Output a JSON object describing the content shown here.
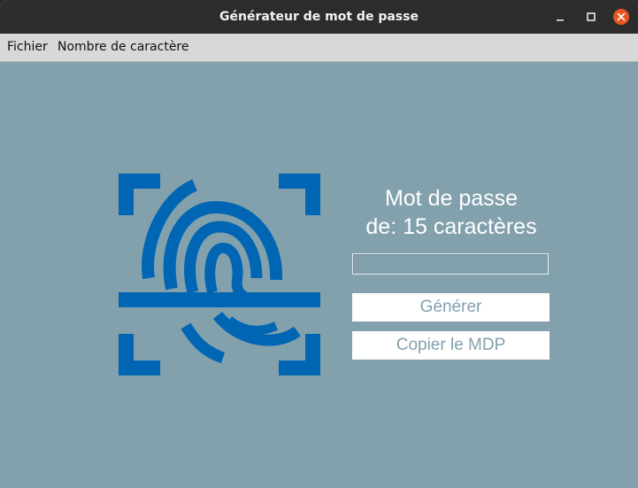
{
  "window": {
    "title": "Générateur de mot de passe",
    "controls": [
      "minimize-icon",
      "maximize-icon",
      "close-icon"
    ]
  },
  "menu": {
    "items": [
      {
        "label": "Fichier"
      },
      {
        "label": "Nombre de caractère"
      }
    ]
  },
  "main": {
    "logo_icon": "fingerprint-scan-icon",
    "heading_line1": "Mot de passe",
    "heading_line2": "de: 15 caractères",
    "password_value": "",
    "generate_label": "Générer",
    "copy_label": "Copier le MDP"
  },
  "colors": {
    "background": "#82a1ad",
    "logo": "#0066b3",
    "titlebar": "#2c2c2c",
    "close_button": "#e95420"
  }
}
